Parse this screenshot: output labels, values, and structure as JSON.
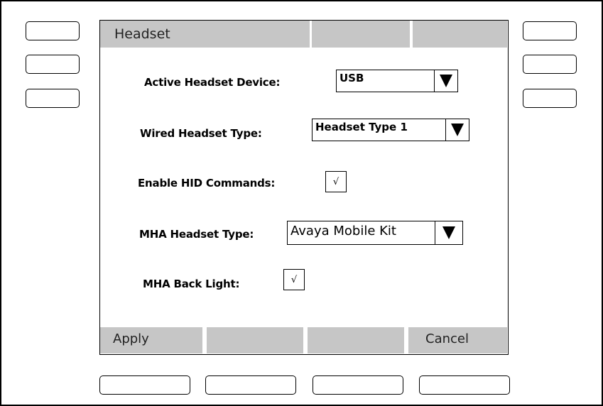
{
  "screen": {
    "title": "Headset",
    "fields": {
      "active_device": {
        "label": "Active Headset Device:",
        "value": "USB"
      },
      "wired_type": {
        "label": "Wired Headset Type:",
        "value": "Headset Type 1"
      },
      "hid_commands": {
        "label": "Enable HID Commands:",
        "checked_mark": "√"
      },
      "mha_type": {
        "label": "MHA Headset Type:",
        "value": "Avaya Mobile Kit"
      },
      "mha_backlight": {
        "label": "MHA Back Light:",
        "checked_mark": "√"
      }
    },
    "softkeys": {
      "apply": "Apply",
      "key2": "",
      "key3": "",
      "cancel": "Cancel"
    }
  },
  "icons": {
    "dropdown": "triangle-down-icon"
  },
  "colors": {
    "bar_gray": "#c6c6c6",
    "border": "#000000",
    "background": "#ffffff"
  }
}
